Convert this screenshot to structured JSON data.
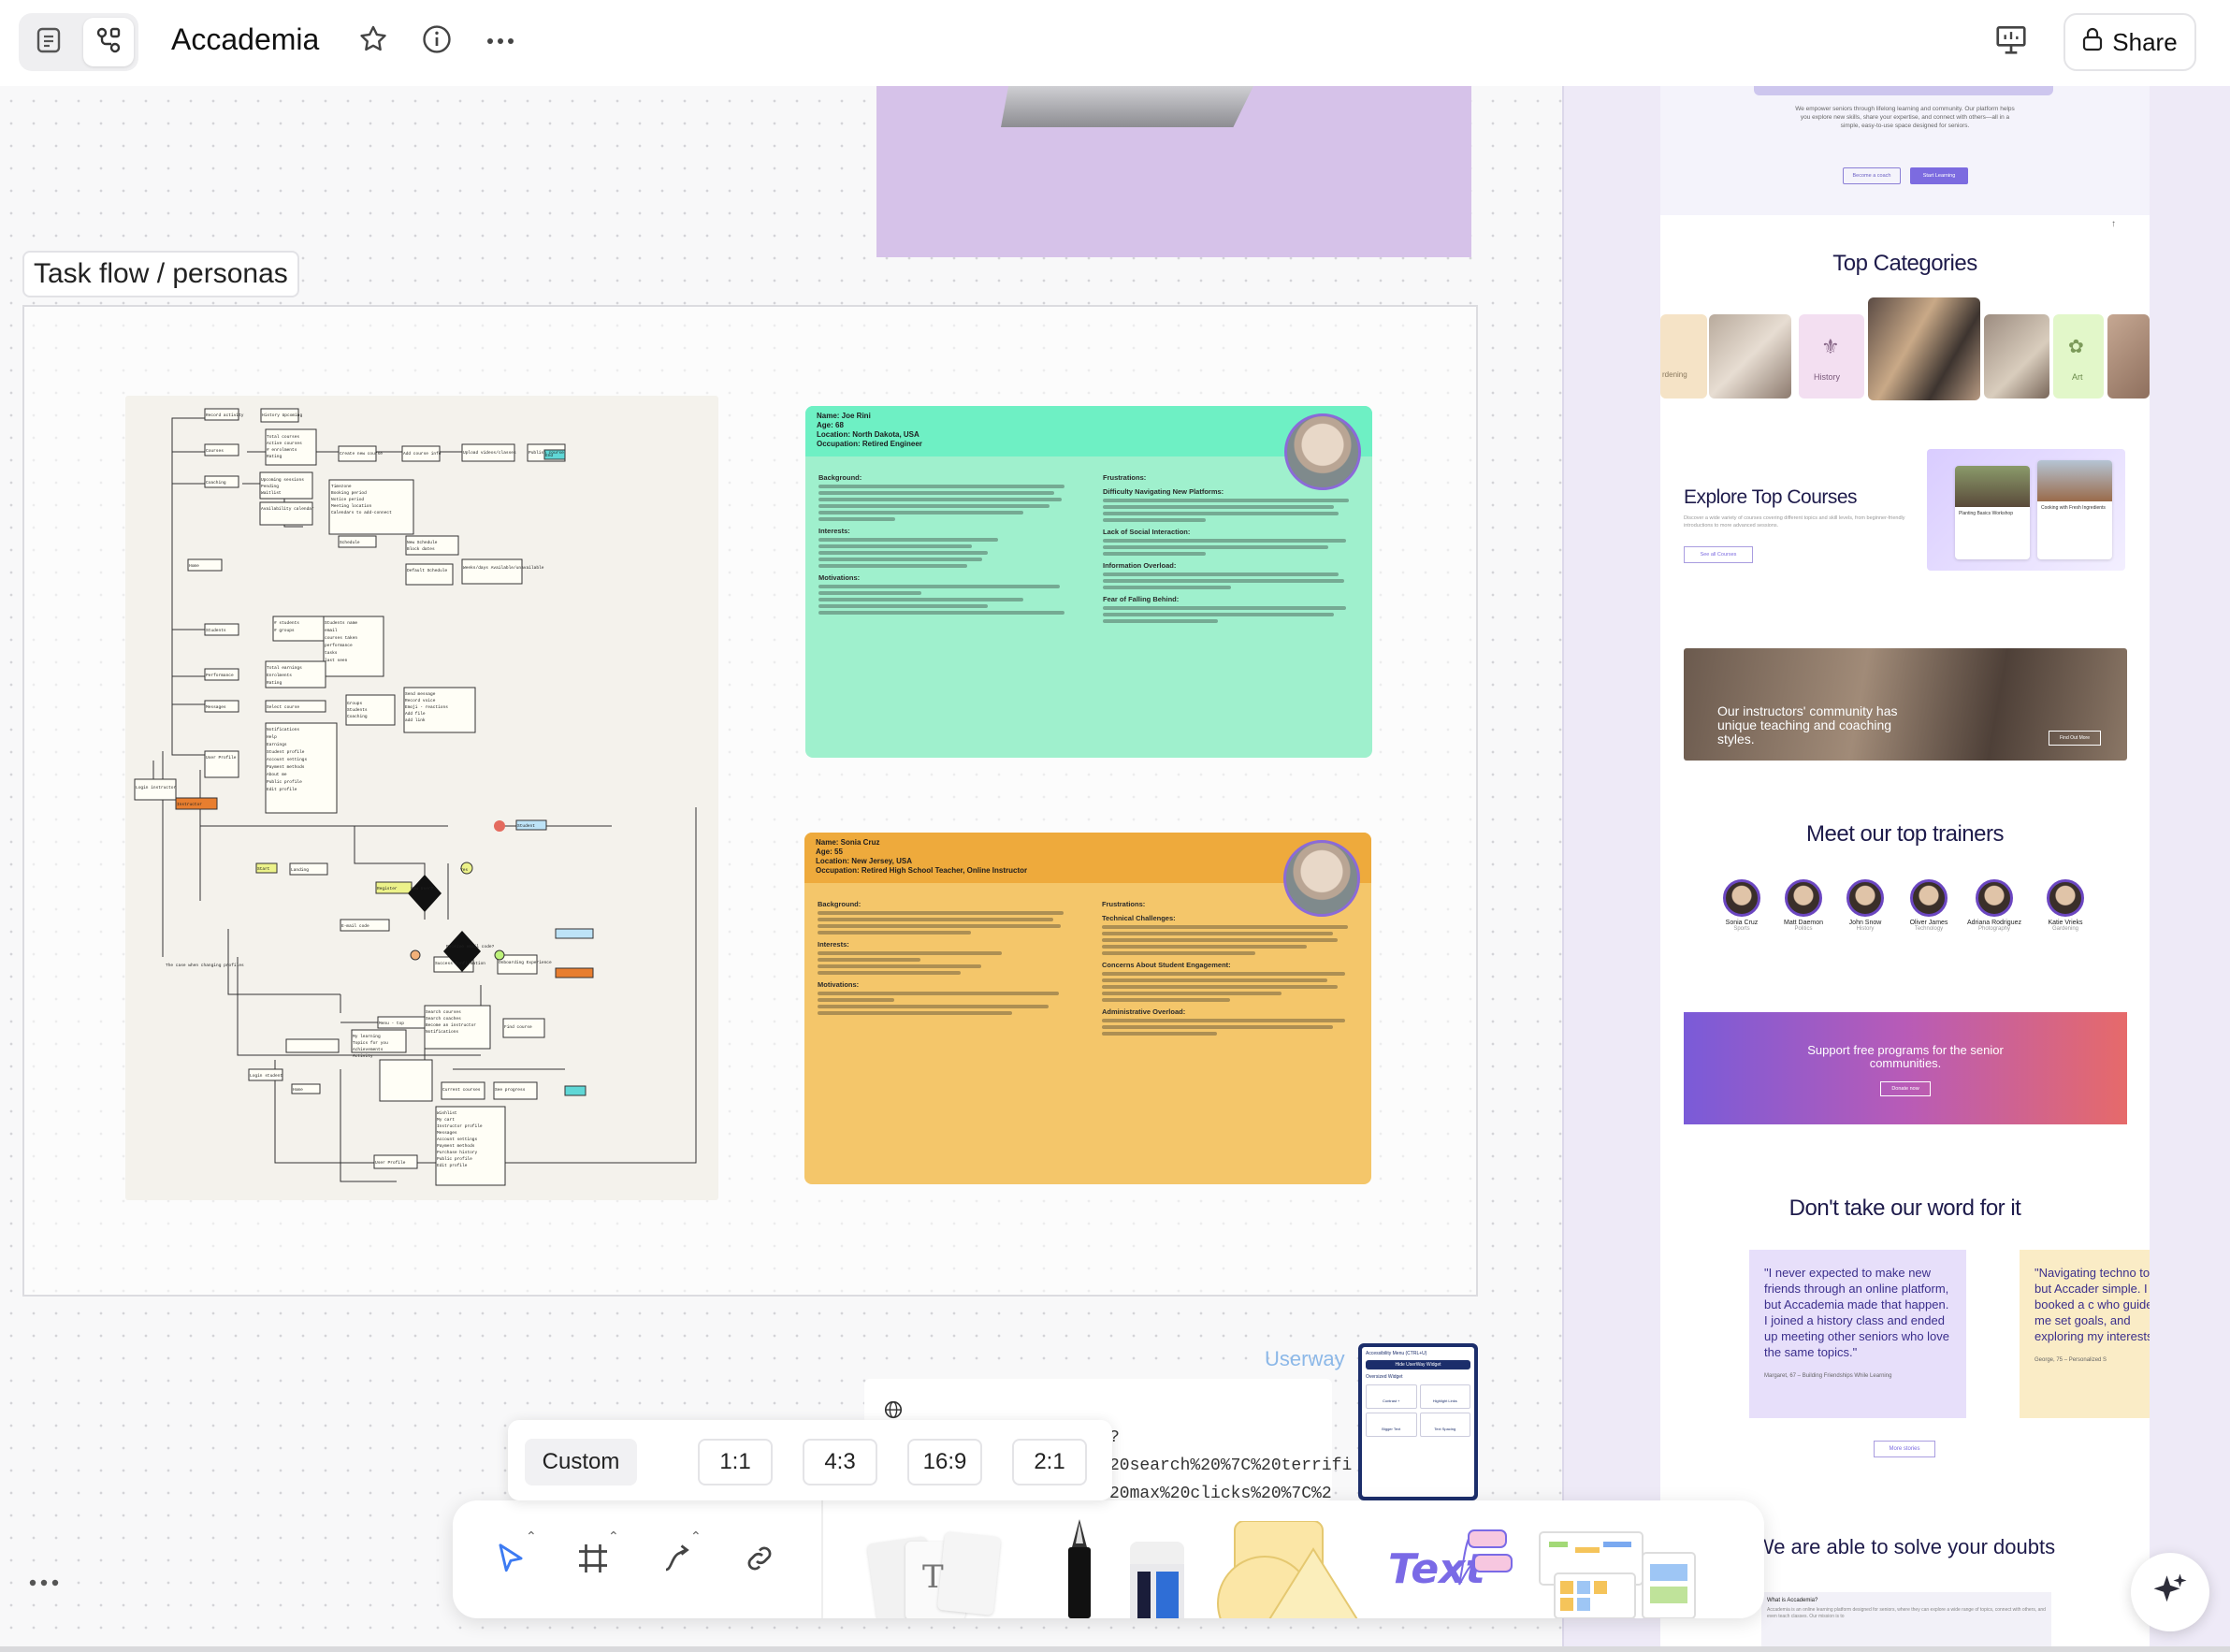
{
  "header": {
    "title": "Accademia",
    "share_label": "Share"
  },
  "canvas": {
    "frame_label": "Task flow / personas",
    "userway_label": "Userway",
    "note_lines": [
      "?",
      "20search%20%7C%20terrifi",
      "20max%20clicks%20%7C%2"
    ]
  },
  "flow_labels": [
    "Record activity",
    "History Upcoming",
    "Courses",
    "Total courses",
    "Active courses",
    "# enrolments",
    "Rating",
    "Create new course",
    "Add course info",
    "Upload videos/classes",
    "Publish course",
    "End",
    "Coaching",
    "Upcoming sessions",
    "Pending",
    "Waitlist",
    "Availability calendar",
    "Timezone",
    "Booking period",
    "Notice period",
    "Meeting location",
    "Calendars to add-connect",
    "Schedule",
    "New Schedule",
    "Block dates",
    "Default Schedule",
    "Weeks/days Available/unavailable",
    "Home",
    "Students",
    "# students",
    "# groups",
    "Students name",
    "email",
    "courses taken",
    "performance",
    "tasks",
    "last seen",
    "Performance",
    "Total earnings",
    "Enrolments",
    "Rating",
    "Messages",
    "Select course",
    "Groups",
    "Students",
    "Coaching",
    "Send message",
    "Record voice",
    "Emoji - reactions",
    "Add file",
    "add link",
    "User Profile",
    "Notifications",
    "Help",
    "Earnings",
    "Student profile",
    "Account settings",
    "Payment methods",
    "About me",
    "Public profile",
    "Edit profile",
    "Login instructor",
    "Instructor",
    "Start",
    "Landing",
    "New User?",
    "Yes",
    "Register",
    "E-mail code",
    "Student",
    "Receive email code?",
    "Success Confirmation",
    "Onboarding Experience",
    "The case when changing profiles",
    "Search courses",
    "Search coaches",
    "Become an instructor",
    "Notifications",
    "Find course",
    "Menu - top",
    "Login student",
    "Home",
    "My learning",
    "Topics for you",
    "Achievements",
    "Activity",
    "Current courses",
    "See progress",
    "Wishlist",
    "My cart",
    "Instructor profile",
    "Messages",
    "Account settings",
    "Payment methods",
    "Purchase history",
    "Public profile",
    "Edit profile",
    "User Profile"
  ],
  "personas": [
    {
      "header": [
        "Name: Joe Rini",
        "Age: 68",
        "Location: North Dakota, USA",
        "Occupation: Retired Engineer"
      ],
      "left_headings": [
        "Background:",
        "Interests:",
        "Motivations:"
      ],
      "right_headings": [
        "Frustrations:",
        "Difficulty Navigating New Platforms:",
        "Lack of Social Interaction:",
        "Information Overload:",
        "Fear of Falling Behind:"
      ],
      "color": "#9ff0cd"
    },
    {
      "header": [
        "Name: Sonia Cruz",
        "Age: 55",
        "Location: New Jersey, USA",
        "Occupation: Retired High School Teacher, Online Instructor"
      ],
      "left_headings": [
        "Background:",
        "Interests:",
        "Motivations:"
      ],
      "right_headings": [
        "Frustrations:",
        "Technical Challenges:",
        "Concerns About Student Engagement:",
        "Administrative Overload:"
      ],
      "color": "#f4c66a"
    }
  ],
  "mockup": {
    "hero_text": "We empower seniors through lifelong learning and community. Our platform helps you explore new skills, share your expertise, and connect with others—all in a simple, easy-to-use space designed for seniors.",
    "hero_buttons": [
      "Become a coach",
      "Start Learning"
    ],
    "categories_title": "Top Categories",
    "category_labels": [
      "rdening",
      "History",
      "Art"
    ],
    "explore_title": "Explore Top Courses",
    "explore_text": "Discover a wide variety of courses covering different topics and skill levels, from beginner-friendly introductions to more advanced sessions.",
    "explore_button": "See all Courses",
    "course_cards": [
      "Planting Basics Workshop",
      "Cooking with Fresh Ingredients"
    ],
    "banner_title": "Our instructors' community has unique teaching and coaching styles.",
    "banner_button": "Find Out More",
    "trainers_title": "Meet our top trainers",
    "trainers": [
      {
        "name": "Sonia Cruz",
        "role": "Sports"
      },
      {
        "name": "Matt Daemon",
        "role": "Politics"
      },
      {
        "name": "John Snow",
        "role": "History"
      },
      {
        "name": "Oliver James",
        "role": "Technology"
      },
      {
        "name": "Adriana Rodriguez",
        "role": "Photography"
      },
      {
        "name": "Katie Vrieks",
        "role": "Gardening"
      }
    ],
    "support_title": "Support free programs for the senior communities.",
    "support_button": "Donate now",
    "testimonials_title": "Don't take our word for it",
    "testimonials": [
      {
        "quote": "\"I never expected to make new friends through an online platform, but Accademia made that happen. I joined a history class and ended up meeting other seniors who love the same topics.\"",
        "author": "Margaret, 67 – Building Friendships While Learning"
      },
      {
        "quote": "\"Navigating techno tough, but Accader simple. I booked a c who guided me set goals, and exploring my interests.\"",
        "author": "George, 75 – Personalized S"
      }
    ],
    "more_stories": "More stories",
    "faq_title": "We are able to solve your doubts",
    "faq_question": "What is Accademia?",
    "faq_answer": "Accademia is an online learning platform designed for seniors, where they can explore a wide range of topics, connect with others, and even teach classes. Our mission is to"
  },
  "aspect_options": [
    "Custom",
    "1:1",
    "4:3",
    "16:9",
    "2:1"
  ],
  "accessibility_panel": {
    "title": "Accessibility Menu (CTRL+U)",
    "option": "Hide UserWay Widget",
    "items": [
      "Oversized Widget",
      "Contrast +",
      "Highlight Links",
      "Bigger Text",
      "Text Spacing"
    ]
  },
  "colors": {
    "persona_green": "#9ff0cd",
    "persona_orange": "#f4c66a",
    "accent_purple": "#6b46c1",
    "canvas_bg": "#f8f8f9"
  }
}
